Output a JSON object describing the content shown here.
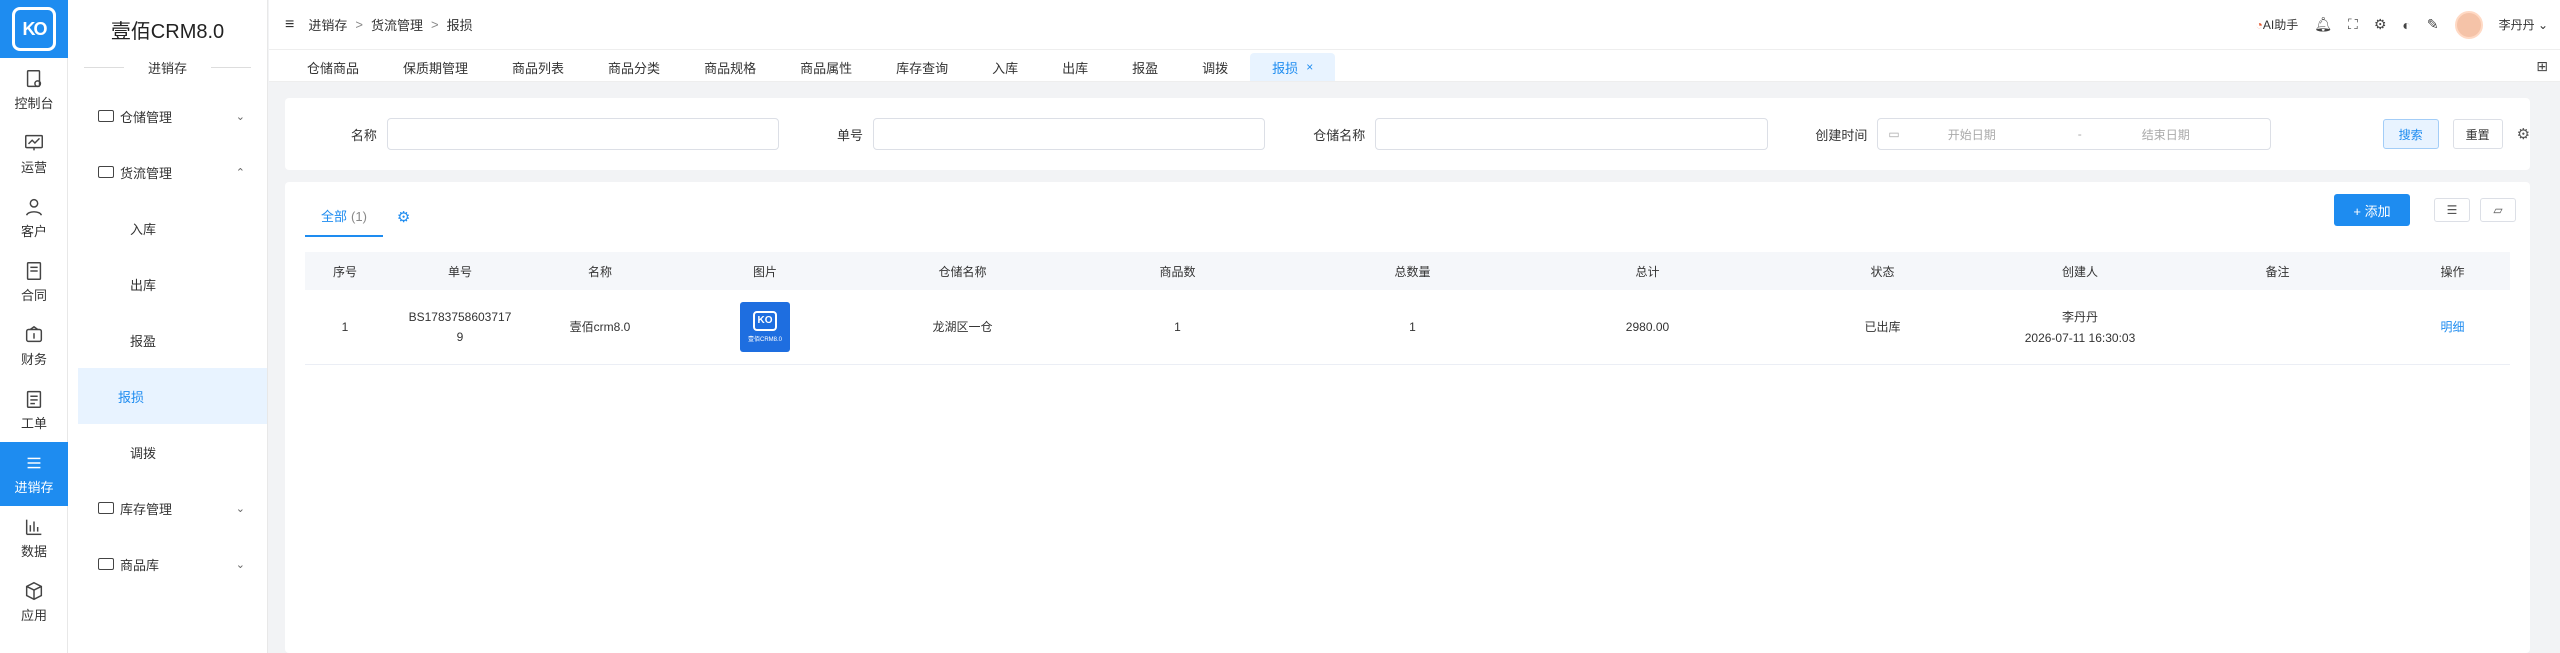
{
  "rail": {
    "logo_text": "KO",
    "items": [
      {
        "label": "控制台",
        "icon": "dashboard-icon"
      },
      {
        "label": "运营",
        "icon": "chart-line-icon"
      },
      {
        "label": "客户",
        "icon": "user-icon"
      },
      {
        "label": "合同",
        "icon": "contract-icon"
      },
      {
        "label": "财务",
        "icon": "wallet-icon"
      },
      {
        "label": "工单",
        "icon": "clipboard-icon"
      },
      {
        "label": "进销存",
        "icon": "list-icon"
      },
      {
        "label": "数据",
        "icon": "bar-chart-icon"
      },
      {
        "label": "应用",
        "icon": "cube-icon"
      }
    ]
  },
  "submenu": {
    "brand": "壹佰CRM8.0",
    "section_title": "进销存",
    "groups": [
      {
        "label": "仓储管理",
        "chevron": "⌄"
      },
      {
        "label": "货流管理",
        "chevron": "⌃"
      },
      {
        "label": "库存管理",
        "chevron": "⌄"
      },
      {
        "label": "商品库",
        "chevron": "⌄"
      }
    ],
    "sub_items": [
      "入库",
      "出库",
      "报盈",
      "报损",
      "调拨"
    ]
  },
  "topbar": {
    "breadcrumb": [
      "进销存",
      "货流管理",
      "报损"
    ],
    "ai_label": "AI助手",
    "user_name": "李丹丹"
  },
  "tabs": [
    {
      "label": "仓储商品"
    },
    {
      "label": "保质期管理"
    },
    {
      "label": "商品列表"
    },
    {
      "label": "商品分类"
    },
    {
      "label": "商品规格"
    },
    {
      "label": "商品属性"
    },
    {
      "label": "库存查询"
    },
    {
      "label": "入库"
    },
    {
      "label": "出库"
    },
    {
      "label": "报盈"
    },
    {
      "label": "调拨"
    },
    {
      "label": "报损",
      "close": "×"
    }
  ],
  "search": {
    "name_label": "名称",
    "number_label": "单号",
    "warehouse_label": "仓储名称",
    "created_label": "创建时间",
    "start_placeholder": "开始日期",
    "range_sep": "-",
    "end_placeholder": "结束日期",
    "search_btn": "搜索",
    "reset_btn": "重置"
  },
  "list": {
    "tab_label": "全部",
    "tab_count": "(1)",
    "add_btn": "+ 添加",
    "columns": [
      "序号",
      "单号",
      "名称",
      "图片",
      "仓储名称",
      "商品数",
      "总数量",
      "总计",
      "状态",
      "创建人",
      "备注",
      "操作"
    ],
    "rows": [
      {
        "index": "1",
        "number_line1": "BS17837586037​17",
        "number_line2": "9",
        "name": "壹佰crm8.0",
        "thumb_logo": "KO",
        "thumb_caption": "壹佰CRM8.0",
        "warehouse": "龙湖区一仓",
        "goods_count": "1",
        "total_qty": "1",
        "total": "2980.00",
        "status": "已出库",
        "creator": "李丹丹",
        "created_at": "2026-07-11 16:30:03",
        "remark": "",
        "action": "明细"
      }
    ]
  },
  "colors": {
    "accent": "#1e8cf0",
    "active_bg": "#e8f3ff"
  }
}
